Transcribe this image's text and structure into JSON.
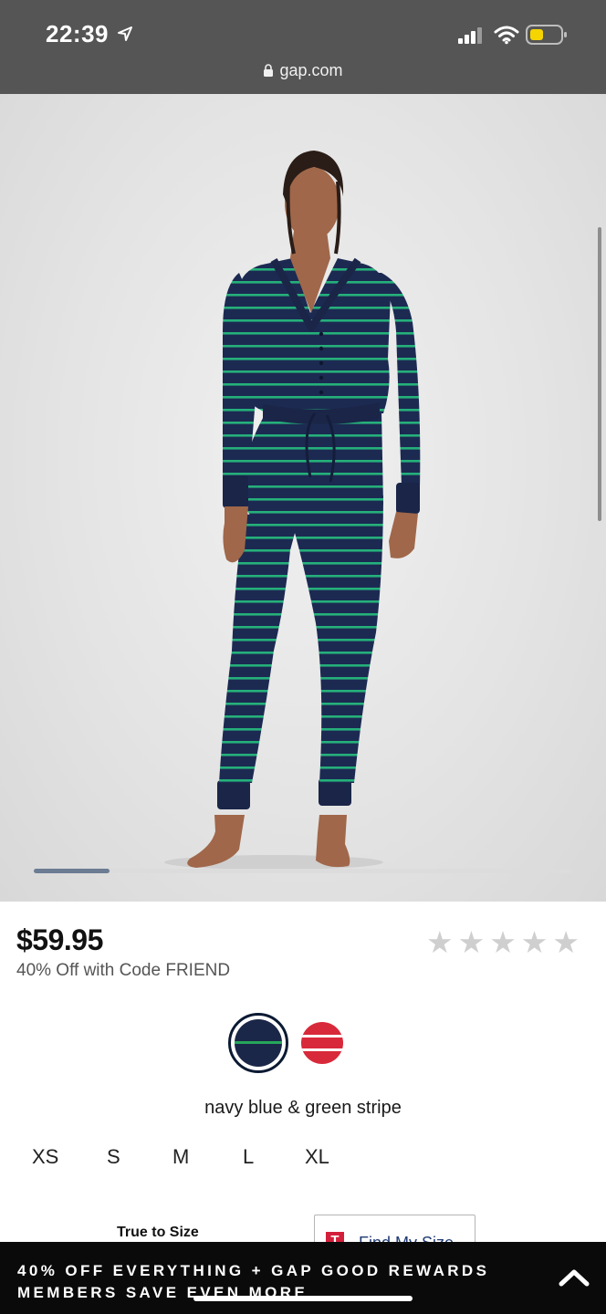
{
  "status_bar": {
    "time": "22:39",
    "url": "gap.com"
  },
  "carousel": {
    "progress_fraction": 0.14
  },
  "product": {
    "price": "$59.95",
    "promo": "40% Off with Code FRIEND",
    "rating_stars_filled": 0,
    "rating_stars_total": 5,
    "selected_color": "navy blue & green stripe",
    "colors": [
      {
        "name": "navy blue & green stripe",
        "hex": "#1b2748",
        "stripe": "#26a65b",
        "selected": true
      },
      {
        "name": "red stripe",
        "hex": "#d8293a",
        "stripe": "#ffffff",
        "selected": false
      }
    ],
    "sizes": [
      "XS",
      "S",
      "M",
      "L",
      "XL"
    ],
    "fit_label": "True to Size",
    "find_my_size": {
      "logo": "T",
      "label": "Find My Size"
    }
  },
  "banner": {
    "text": "40% OFF EVERYTHING + GAP GOOD REWARDS MEMBERS SAVE EVEN MORE"
  },
  "colors": {
    "status_bg": "#555555",
    "banner_bg": "#0a0a0a",
    "star_inactive": "#cfcfcf",
    "carousel_fill": "#6b7c93"
  }
}
